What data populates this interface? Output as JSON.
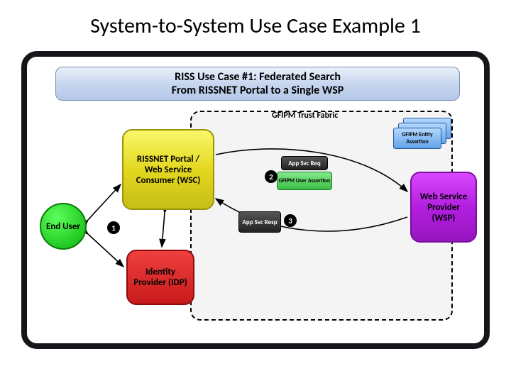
{
  "title": "System-to-System Use Case Example 1",
  "banner": {
    "line1": "RISS Use Case #1: Federated Search",
    "line2": "From RISSNET Portal to a Single WSP"
  },
  "trust_fabric_label": "GFIPM Trust Fabric",
  "nodes": {
    "end_user": "End User",
    "rissnet": "RISSNET Portal / Web Service Consumer (WSC)",
    "idp": "Identity Provider (IDP)",
    "wsp": "Web Service Provider (WSP)",
    "entity_assertion": "GFIPM Entity Assertion",
    "app_svc_req": "App Svc Req",
    "user_assertion": "GFIPM User Assertion",
    "app_svc_resp": "App Svc Resp"
  },
  "steps": {
    "s1": "1",
    "s2": "2",
    "s3": "3"
  }
}
